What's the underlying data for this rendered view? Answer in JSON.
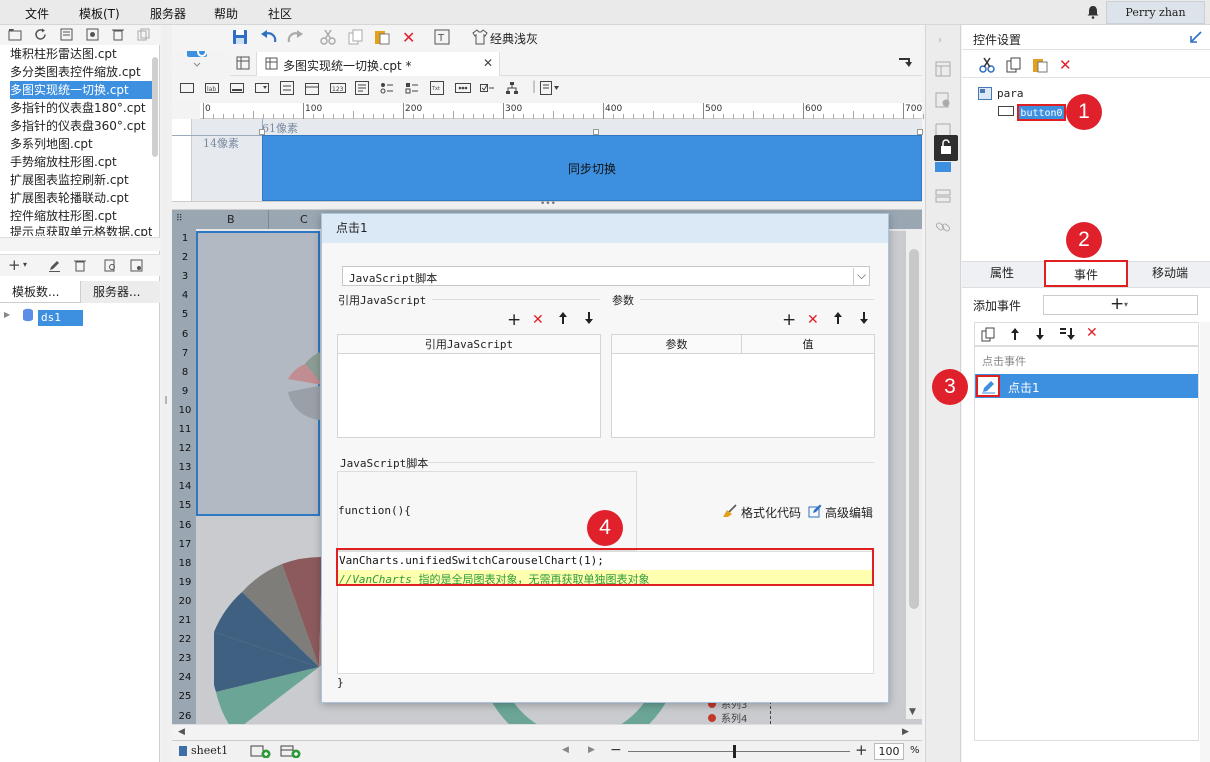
{
  "menubar": {
    "items": [
      "文件",
      "模板(T)",
      "服务器",
      "帮助",
      "社区"
    ],
    "user": "Perry zhan"
  },
  "left": {
    "files": [
      "堆积柱形雷达图.cpt",
      "多分类图表控件缩放.cpt",
      "多图实现统一切换.cpt",
      "多指针的仪表盘180°.cpt",
      "多指针的仪表盘360°.cpt",
      "多系列地图.cpt",
      "手势缩放柱形图.cpt",
      "扩展图表监控刷新.cpt",
      "扩展图表轮播联动.cpt",
      "控件缩放柱形图.cpt",
      "提示点获取单元格数据.cpt"
    ],
    "tabs": [
      "模板数...",
      "服务器..."
    ],
    "datasource": "ds1"
  },
  "toolbar": {
    "style_label": "经典浅灰"
  },
  "tab": {
    "title": "多图实现统一切换.cpt *"
  },
  "ruler": {
    "marks": [
      "0",
      "100",
      "200",
      "300",
      "400",
      "500",
      "600",
      "700"
    ]
  },
  "param": {
    "px_label_left": "14像素",
    "px_label_top": "61像素",
    "button_text": "同步切换"
  },
  "sheet": {
    "columns": [
      "B",
      "C"
    ],
    "rows": [
      "1",
      "2",
      "3",
      "4",
      "5",
      "6",
      "7",
      "8",
      "9",
      "10",
      "11",
      "12",
      "13",
      "14",
      "15",
      "16",
      "17",
      "18",
      "19",
      "20",
      "21",
      "22",
      "23",
      "24",
      "25",
      "26"
    ],
    "legend_a": "系列3",
    "legend_b": "系列4",
    "sheet_name": "sheet1",
    "zoom": "100",
    "zoom_unit": "%"
  },
  "dialog": {
    "title": "点击1",
    "type_select": "JavaScript脚本",
    "ref_label": "引用JavaScript",
    "param_label": "参数",
    "ref_col": "引用JavaScript",
    "param_col": "参数",
    "value_col": "值",
    "script_label": "JavaScript脚本",
    "func_open": "function(){",
    "format_label": "格式化代码",
    "advanced_label": "高级编辑",
    "code_line1": "VanCharts.unifiedSwitchCarouselChart(1);",
    "code_line2_comment": "//VanCharts",
    "code_line2_rest": "指的是全局图表对象，无需再获取单独图表对象",
    "func_close": "}"
  },
  "right": {
    "title": "控件设置",
    "tree_root": "para",
    "tree_child": "button0",
    "tabs": [
      "属性",
      "事件",
      "移动端"
    ],
    "add_event_label": "添加事件",
    "event_group": "点击事件",
    "event_item": "点击1"
  },
  "markers": [
    "1",
    "2",
    "3",
    "4"
  ],
  "colors": {
    "accent": "#3d8fe0",
    "marker": "#e0202a",
    "highlight": "#ffffb0"
  }
}
